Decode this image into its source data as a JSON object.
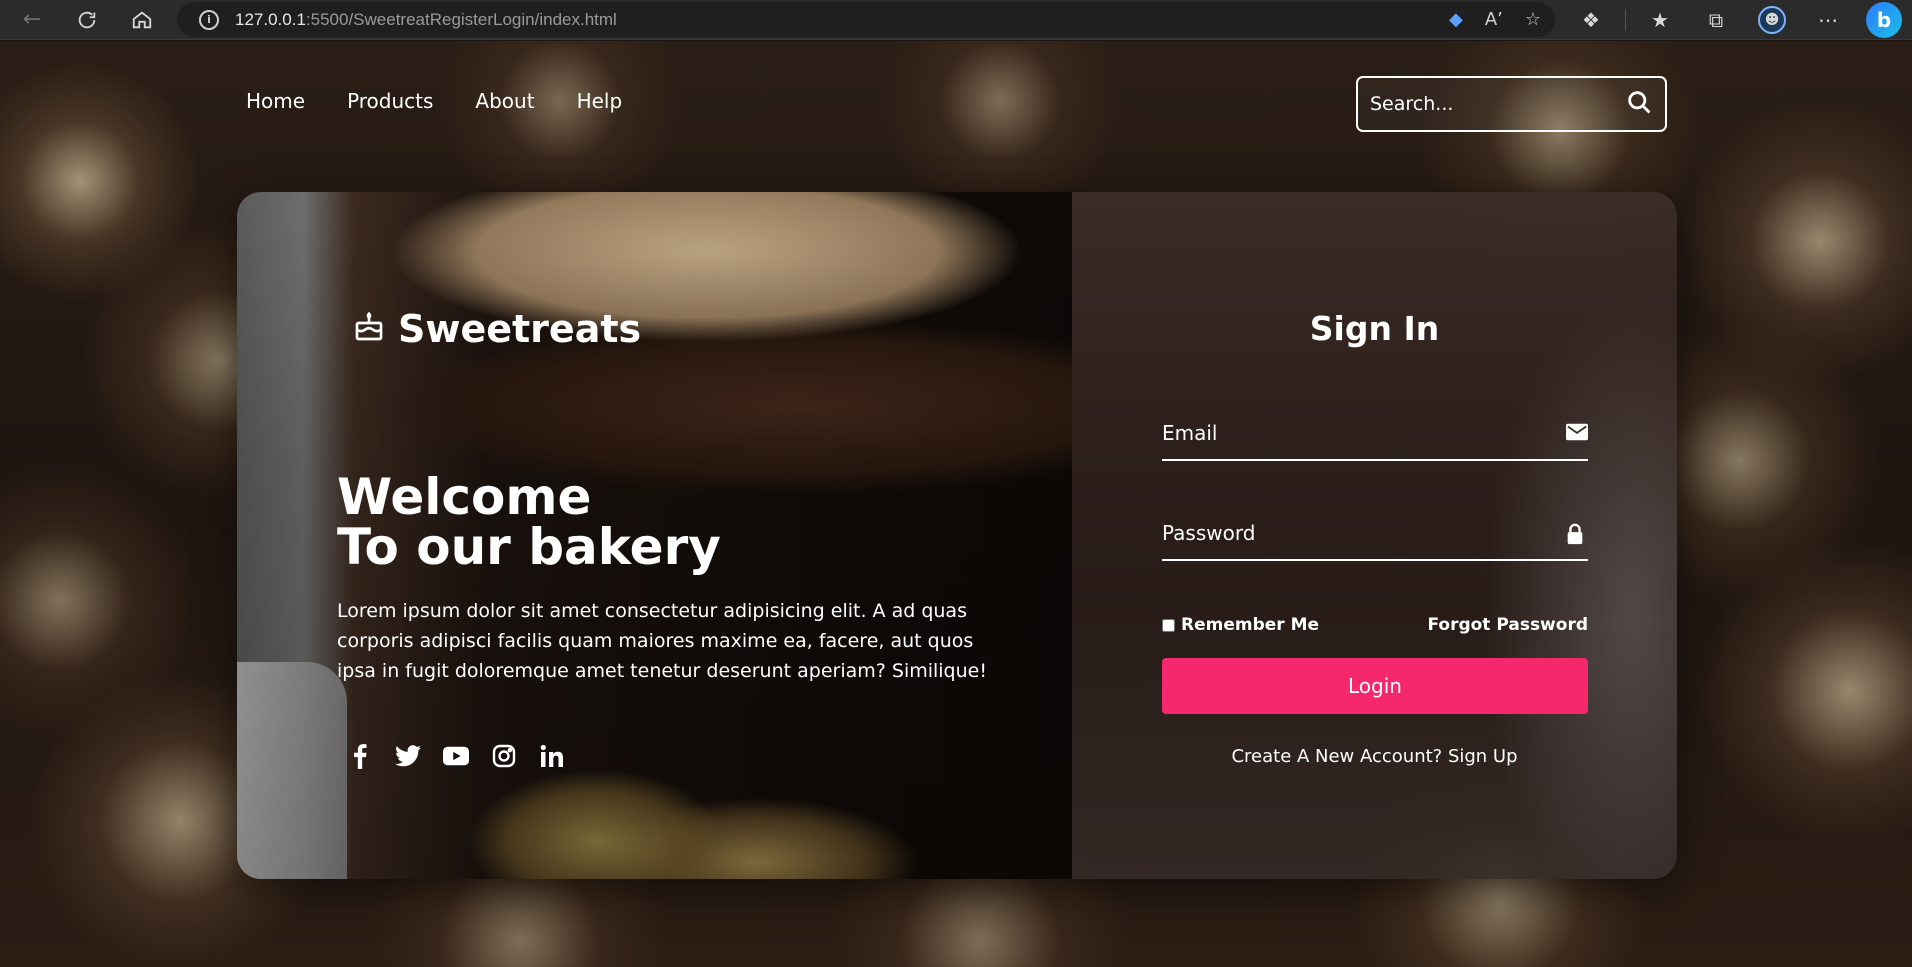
{
  "browser": {
    "url_host": "127.0.0.1",
    "url_path": ":5500/SweetreatRegisterLogin/index.html"
  },
  "nav": {
    "items": [
      {
        "label": "Home"
      },
      {
        "label": "Products"
      },
      {
        "label": "About"
      },
      {
        "label": "Help"
      }
    ]
  },
  "search": {
    "placeholder": "Search..."
  },
  "brand": {
    "name": "Sweetreats"
  },
  "hero": {
    "line1": "Welcome",
    "line2": "To our bakery",
    "description": "Lorem ipsum dolor sit amet consectetur adipisicing elit. A ad quas corporis adipisci facilis quam maiores maxime ea, facere, aut quos ipsa in fugit doloremque amet tenetur deserunt aperiam? Similique!"
  },
  "socials": [
    "facebook",
    "twitter",
    "youtube",
    "instagram",
    "linkedin"
  ],
  "signin": {
    "title": "Sign In",
    "email_placeholder": "Email",
    "password_placeholder": "Password",
    "remember_label": "Remember Me",
    "forgot_label": "Forgot Password",
    "login_label": "Login",
    "create_account_label": "Create A New Account? Sign Up"
  },
  "colors": {
    "accent": "#f5276d"
  }
}
